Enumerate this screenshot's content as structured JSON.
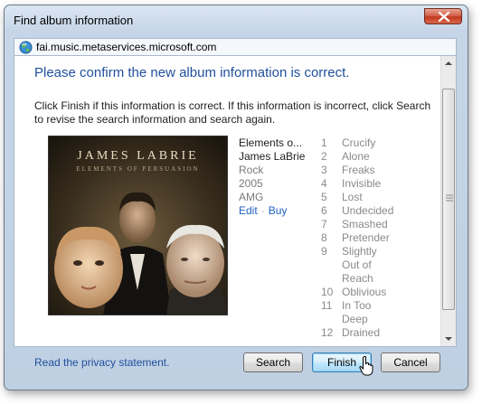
{
  "window": {
    "title": "Find album information"
  },
  "address_bar": {
    "url": "fai.music.metaservices.microsoft.com",
    "icon": "globe-icon"
  },
  "content": {
    "heading": "Please confirm the new album information is correct.",
    "instructions": "Click Finish if this information is correct. If this information is incorrect, click Search to revise the search information and search again."
  },
  "album": {
    "art_title": "JAMES LABRIE",
    "art_subtitle": "ELEMENTS OF PERSUASION",
    "title": "Elements o...",
    "artist": "James LaBrie",
    "genre": "Rock",
    "year": "2005",
    "source": "AMG",
    "edit_label": "Edit",
    "separator": "·",
    "buy_label": "Buy"
  },
  "tracks": [
    {
      "num": "1",
      "name": "Crucify"
    },
    {
      "num": "2",
      "name": "Alone"
    },
    {
      "num": "3",
      "name": "Freaks"
    },
    {
      "num": "4",
      "name": "Invisible"
    },
    {
      "num": "5",
      "name": "Lost"
    },
    {
      "num": "6",
      "name": "Undecided"
    },
    {
      "num": "7",
      "name": "Smashed"
    },
    {
      "num": "8",
      "name": "Pretender"
    },
    {
      "num": "9",
      "name": "Slightly Out of Reach"
    },
    {
      "num": "10",
      "name": "Oblivious"
    },
    {
      "num": "11",
      "name": "In Too Deep"
    },
    {
      "num": "12",
      "name": "Drained"
    }
  ],
  "footer": {
    "privacy_link": "Read the privacy statement.",
    "search_button": "Search",
    "finish_button": "Finish",
    "cancel_button": "Cancel"
  },
  "colors": {
    "heading": "#1f4f9d",
    "link": "#1f5fbf",
    "close_button": "#c23a20"
  }
}
